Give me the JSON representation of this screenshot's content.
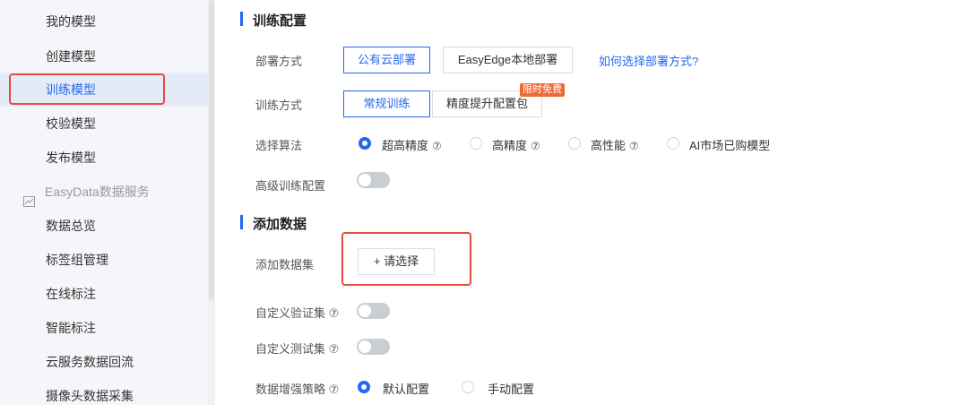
{
  "sidebar": {
    "items": [
      {
        "label": "我的模型"
      },
      {
        "label": "创建模型"
      },
      {
        "label": "训练模型"
      },
      {
        "label": "校验模型"
      },
      {
        "label": "发布模型"
      },
      {
        "label": "EasyData数据服务",
        "icon": "chart-icon"
      },
      {
        "label": "数据总览"
      },
      {
        "label": "标签组管理"
      },
      {
        "label": "在线标注"
      },
      {
        "label": "智能标注"
      },
      {
        "label": "云服务数据回流"
      },
      {
        "label": "摄像头数据采集"
      }
    ],
    "active_index": 2
  },
  "train_config": {
    "title": "训练配置",
    "deploy": {
      "label": "部署方式",
      "options": [
        "公有云部署",
        "EasyEdge本地部署"
      ],
      "selected": "公有云部署",
      "help_link": "如何选择部署方式?"
    },
    "mode": {
      "label": "训练方式",
      "options": [
        "常规训练",
        "精度提升配置包"
      ],
      "selected": "常规训练",
      "badge": "限时免费"
    },
    "algorithm": {
      "label": "选择算法",
      "options": [
        "超高精度",
        "高精度",
        "高性能",
        "AI市场已购模型"
      ],
      "selected": "超高精度",
      "help_glyph": "⑦"
    },
    "advanced": {
      "label": "高级训练配置",
      "enabled": false
    }
  },
  "add_data": {
    "title": "添加数据",
    "dataset_label": "添加数据集",
    "choose_button": "+ 请选择",
    "custom_val": {
      "label": "自定义验证集 ⑦",
      "enabled": false
    },
    "custom_test": {
      "label": "自定义测试集 ⑦",
      "enabled": false
    },
    "augment": {
      "label": "数据增强策略 ⑦",
      "options": [
        "默认配置",
        "手动配置"
      ],
      "selected": "默认配置"
    }
  },
  "colors": {
    "accent": "#2468f2",
    "highlight_box": "#e74c3c",
    "badge": "#f06a35"
  }
}
